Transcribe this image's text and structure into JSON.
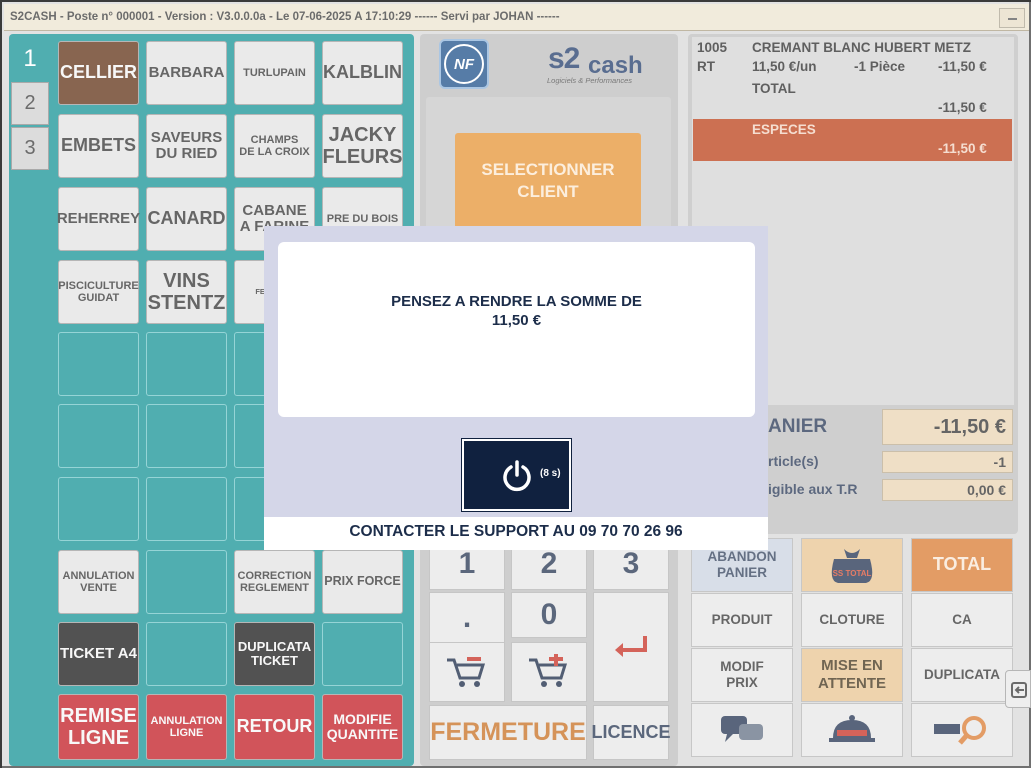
{
  "window": {
    "title": "S2CASH - Poste n° 000001 - Version : V3.0.0.0a - Le 07-06-2025 A 17:10:29 ------ Servi par JOHAN ------"
  },
  "pages": {
    "tabs": [
      "1",
      "2",
      "3"
    ],
    "active": "1"
  },
  "categories": [
    {
      "label": "CELLIER"
    },
    {
      "label": "BARBARA"
    },
    {
      "label": "TURLUPAIN"
    },
    {
      "label": "KALBLIN"
    },
    {
      "label": "EMBETS"
    },
    {
      "label": "SAVEURS\nDU RIED"
    },
    {
      "label": "CHAMPS\nDE LA CROIX"
    },
    {
      "label": "JACKY\nFLEURS"
    },
    {
      "label": "REHERREY"
    },
    {
      "label": "CANARD"
    },
    {
      "label": "CABANE\nA FARINE"
    },
    {
      "label": "PRE DU BOIS"
    },
    {
      "label": "PISCICULTURE\nGUIDAT"
    },
    {
      "label": "VINS\nSTENTZ"
    },
    {
      "label": "FERME F..."
    }
  ],
  "actions": {
    "annulation_vente": "ANNULATION\nVENTE",
    "correction_reglement": "CORRECTION\nREGLEMENT",
    "prix_force": "PRIX FORCE",
    "ticket_a4": "TICKET A4",
    "duplicata_ticket": "DUPLICATA\nTICKET",
    "remise_ligne": "REMISE\nLIGNE",
    "annulation_ligne": "ANNULATION\nLIGNE",
    "retour": "RETOUR",
    "modifie_quantite": "MODIFIE\nQUANTITE"
  },
  "logos": {
    "nf": "NF",
    "s2": "s2",
    "cash": "cash",
    "tagline": "Logiciels & Performances"
  },
  "select_client": "SELECTIONNER\nCLIENT",
  "numpad": {
    "k1": "1",
    "k2": "2",
    "k3": "3",
    "dot": ".",
    "k0": "0",
    "fermeture": "FERMETURE",
    "licence": "LICENCE"
  },
  "ticket": {
    "code": "1005",
    "product": "CREMANT BLANC HUBERT METZ",
    "line_tag": "RT",
    "unit_price": "11,50 €/un",
    "qty": "-1 Pièce",
    "line_total": "-11,50 €",
    "total_label": "TOTAL",
    "total_value": "-11,50 €",
    "payment_label": "ESPECES",
    "payment_value": "-11,50 €"
  },
  "summary": {
    "panier_label": "ANIER",
    "panier_value": "-11,50 €",
    "articles_label": "rticle(s)",
    "articles_value": "-1",
    "tr_label": "igible aux T.R",
    "tr_value": "0,00 €"
  },
  "functions": {
    "abandon": "ABANDON\nPANIER",
    "total": "TOTAL",
    "produit": "PRODUIT",
    "cloture": "CLOTURE",
    "ca": "CA",
    "modif_prix": "MODIF\nPRIX",
    "mise_en_attente": "MISE EN\nATTENTE",
    "duplicata": "DUPLICATA",
    "bag_label": "SS TOTAL"
  },
  "modal": {
    "line1": "PENSEZ A RENDRE LA SOMME DE",
    "line2": "11,50 €",
    "countdown": "(8 s)",
    "support": "CONTACTER LE SUPPORT AU 09 70 70 26 96"
  },
  "colors": {
    "teal": "#0d8f92",
    "brown": "#5a2a0d",
    "red": "#c0121b",
    "orange": "#e5902e",
    "navy": "#10213f"
  }
}
